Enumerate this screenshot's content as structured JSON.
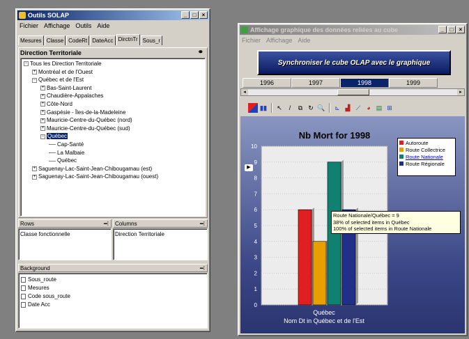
{
  "left_window": {
    "title": "Outils SOLAP",
    "menu": [
      "Fichier",
      "Affichage",
      "Outils",
      "Aide"
    ],
    "tabs": [
      "Mesures",
      "Classe",
      "CodeRt",
      "DateAcc",
      "DirctnTr",
      "Sous_r"
    ],
    "active_tab": 4,
    "dimension_title": "Direction Territoriale",
    "tree": [
      {
        "label": "Tous les Direction Territoriale",
        "level": 0,
        "box": "−"
      },
      {
        "label": "Montréal et de l'Ouest",
        "level": 1,
        "box": "+"
      },
      {
        "label": "Québec et de l'Est",
        "level": 1,
        "box": "−"
      },
      {
        "label": "Bas-Saint-Laurent",
        "level": 2,
        "box": "+"
      },
      {
        "label": "Chaudière-Appalaches",
        "level": 2,
        "box": "+"
      },
      {
        "label": "Côte-Nord",
        "level": 2,
        "box": "+"
      },
      {
        "label": "Gaspésie - Îles-de-la-Madeleine",
        "level": 2,
        "box": "+"
      },
      {
        "label": "Mauricie-Centre-du-Québec (nord)",
        "level": 2,
        "box": "+"
      },
      {
        "label": "Mauricie-Centre-du-Québec (sud)",
        "level": 2,
        "box": "+"
      },
      {
        "label": "Québec",
        "level": 2,
        "box": "−",
        "selected": true
      },
      {
        "label": "Cap-Santé",
        "level": 3,
        "box": ""
      },
      {
        "label": "La Malbaie",
        "level": 3,
        "box": ""
      },
      {
        "label": "Québec",
        "level": 3,
        "box": ""
      },
      {
        "label": "Saguenay-Lac-Saint-Jean-Chibougamau (est)",
        "level": 1,
        "box": "+"
      },
      {
        "label": "Saguenay-Lac-Saint-Jean-Chibougamau (ouest)",
        "level": 1,
        "box": "+"
      }
    ],
    "rows_title": "Rows",
    "rows_value": "Classe fonctionnelle",
    "columns_title": "Columns",
    "columns_value": "Direction Territoriale",
    "background_title": "Background",
    "background_items": [
      "Sous_route",
      "Mesures",
      "Code sous_route",
      "Date Acc"
    ]
  },
  "right_window": {
    "title": "Affichage graphique des données reliées au cube",
    "menu": [
      "Fichier",
      "Affichage",
      "Aide"
    ],
    "sync_button": "Synchroniser le cube OLAP avec le graphique",
    "years": [
      "1996",
      "1997",
      "1998",
      "1999"
    ],
    "active_year": 2,
    "tooltip": [
      "Route Nationale/Québec = 9",
      "38% of selected items in Québec",
      "100% of selected items in Route Nationale"
    ],
    "colors": {
      "autoroute": "#e02020",
      "collectrice": "#e8a000",
      "nationale": "#108070",
      "regionale": "#20308a",
      "accent": "#0a246a"
    }
  },
  "chart_data": {
    "type": "bar",
    "title": "Nb Mort for 1998",
    "categories": [
      "Québec"
    ],
    "series": [
      {
        "name": "Autoroute",
        "values": [
          6
        ]
      },
      {
        "name": "Route Collectrice",
        "values": [
          4
        ]
      },
      {
        "name": "Route Nationale",
        "values": [
          9
        ]
      },
      {
        "name": "Route Régionale",
        "values": [
          6
        ]
      }
    ],
    "ylim": [
      0,
      10
    ],
    "yticks": [
      "0",
      "1",
      "2",
      "3",
      "4",
      "5",
      "6",
      "7",
      "8",
      "9",
      "10"
    ],
    "xlabel": "Nom Dt in Québec et de l'Est",
    "legend": "top-right"
  }
}
